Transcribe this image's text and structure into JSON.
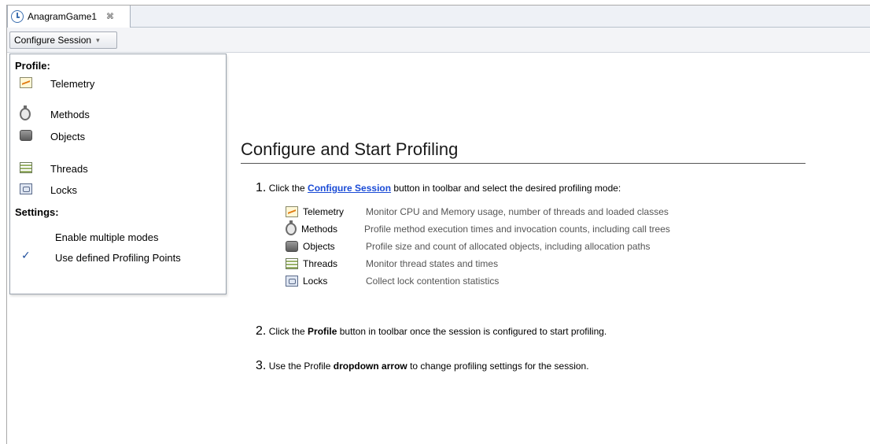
{
  "tab": {
    "title": "AnagramGame1",
    "close": "⌘"
  },
  "toolbar": {
    "configure_label": "Configure Session",
    "caret": "▾"
  },
  "menu": {
    "profile_title": "Profile:",
    "items": [
      {
        "label": "Telemetry",
        "icon": "telemetry-icon"
      },
      {
        "label": "Methods",
        "icon": "methods-icon"
      },
      {
        "label": "Objects",
        "icon": "objects-icon"
      },
      {
        "label": "Threads",
        "icon": "threads-icon"
      },
      {
        "label": "Locks",
        "icon": "locks-icon"
      }
    ],
    "settings_title": "Settings:",
    "settings": [
      {
        "label": "Enable multiple modes",
        "checked": false
      },
      {
        "label": "Use defined Profiling Points",
        "checked": true,
        "mark": "✓"
      }
    ]
  },
  "main": {
    "heading": "Configure and Start Profiling",
    "step1": {
      "num": "1.",
      "pre": "Click the ",
      "link": "Configure Session",
      "post": " button in toolbar and select the desired profiling mode:"
    },
    "modes": [
      {
        "name": "Telemetry",
        "desc": "Monitor CPU and Memory usage, number of threads and loaded classes"
      },
      {
        "name": "Methods",
        "desc": "Profile method execution times and invocation counts, including call trees"
      },
      {
        "name": "Objects",
        "desc": "Profile size and count of allocated objects, including allocation paths"
      },
      {
        "name": "Threads",
        "desc": "Monitor thread states and times"
      },
      {
        "name": "Locks",
        "desc": "Collect lock contention statistics"
      }
    ],
    "step2": {
      "num": "2.",
      "pre": "Click the ",
      "bold": "Profile",
      "post": " button in toolbar once the session is configured to start profiling."
    },
    "step3": {
      "num": "3.",
      "pre": "Use the Profile ",
      "bold": "dropdown arrow",
      "post": " to change profiling settings for the session."
    }
  },
  "colors": {
    "link": "#1a4bd6",
    "check": "#1f4e9c"
  }
}
